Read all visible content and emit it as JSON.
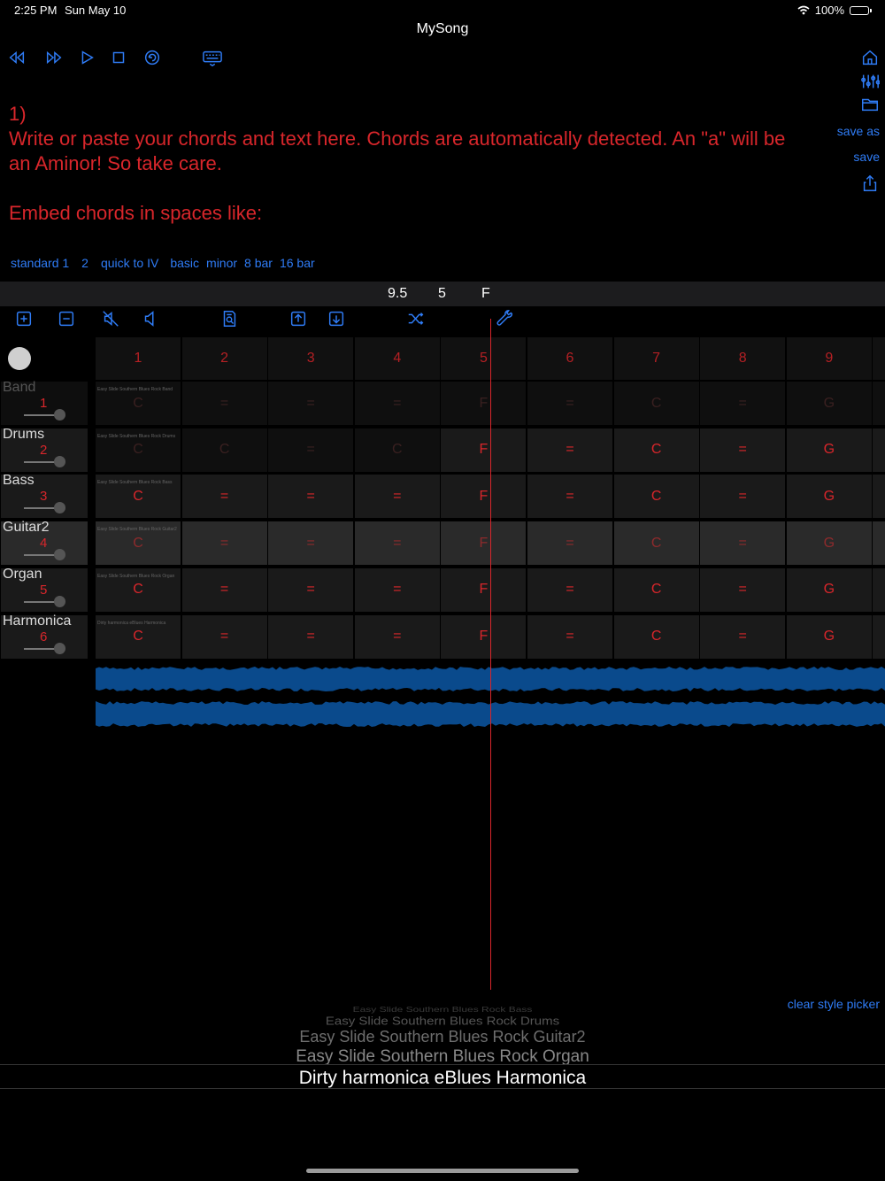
{
  "status": {
    "time": "2:25 PM",
    "date": "Sun May 10",
    "battery": "100%"
  },
  "app": {
    "title": "MySong"
  },
  "transport": {
    "icons": [
      "rewind-icon",
      "fast-forward-icon",
      "play-icon",
      "stop-icon",
      "loop-icon",
      "keyboard-icon"
    ]
  },
  "side": {
    "save_as": "save as",
    "save": "save",
    "icons": [
      "home-icon",
      "tracks-icon",
      "folder-icon",
      "share-icon"
    ]
  },
  "editor": {
    "text": "1)\nWrite or paste your chords and text here. Chords are automatically detected. An \"a\" will be\nan Aminor! So take care.\n\nEmbed chords in spaces like:"
  },
  "templates": [
    "standard 1",
    "2",
    "quick to IV",
    "basic",
    "minor",
    "8 bar",
    "16 bar"
  ],
  "info": {
    "tempo": "9.5",
    "bar": "5",
    "chord": "F"
  },
  "grid_toolbar": {
    "icons": [
      "add-track-icon",
      "remove-track-icon",
      "mute-icon",
      "speaker-icon",
      "search-doc-icon",
      "export-icon",
      "import-icon",
      "shuffle-icon",
      "wrench-icon"
    ]
  },
  "grid": {
    "bars": [
      "1",
      "2",
      "3",
      "4",
      "5",
      "6",
      "7",
      "8",
      "9"
    ],
    "tracks": [
      {
        "name": "Band",
        "num": "1",
        "style": "Easy Slide Southern Blues Rock Band",
        "cells": [
          "C",
          "=",
          "=",
          "=",
          "F",
          "=",
          "C",
          "=",
          "G"
        ],
        "dim": true
      },
      {
        "name": "Drums",
        "num": "2",
        "style": "Easy Slide Southern Blues Rock Drums",
        "cells": [
          "C",
          "C",
          "=",
          "C",
          "F",
          "=",
          "C",
          "=",
          "G"
        ],
        "dim": false
      },
      {
        "name": "Bass",
        "num": "3",
        "style": "Easy Slide Southern Blues Rock Bass",
        "cells": [
          "C",
          "=",
          "=",
          "=",
          "F",
          "=",
          "C",
          "=",
          "G"
        ],
        "dim": false
      },
      {
        "name": "Guitar2",
        "num": "4",
        "style": "Easy Slide Southern Blues Rock Guitar2",
        "cells": [
          "C",
          "=",
          "=",
          "=",
          "F",
          "=",
          "C",
          "=",
          "G"
        ],
        "dim": false
      },
      {
        "name": "Organ",
        "num": "5",
        "style": "Easy Slide Southern Blues Rock Organ",
        "cells": [
          "C",
          "=",
          "=",
          "=",
          "F",
          "=",
          "C",
          "=",
          "G"
        ],
        "dim": false
      },
      {
        "name": "Harmonica",
        "num": "6",
        "style": "Dirty harmonica eBlues Harmonica",
        "cells": [
          "C",
          "=",
          "=",
          "=",
          "F",
          "=",
          "C",
          "=",
          "G"
        ],
        "dim": false
      }
    ]
  },
  "style_picker": {
    "clear_label": "clear style picker",
    "options": [
      "Easy Slide Southern Blues Rock Bass",
      "Easy Slide Southern Blues Rock Drums",
      "Easy Slide Southern Blues Rock Guitar2",
      "Easy Slide Southern Blues Rock Organ",
      "Dirty harmonica eBlues Harmonica"
    ],
    "selected": "Dirty harmonica eBlues Harmonica"
  },
  "colors": {
    "accent": "#2f7cf6",
    "chord": "#d8262b",
    "wave": "#0a4a8c"
  }
}
